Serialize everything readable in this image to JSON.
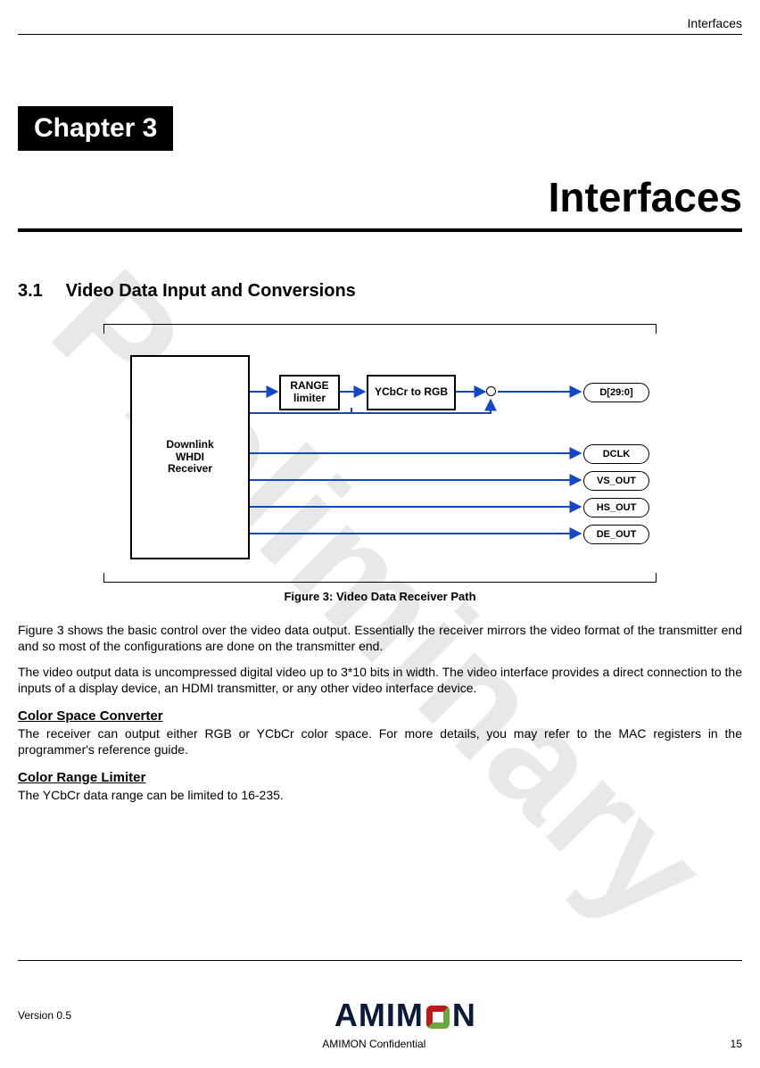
{
  "header": {
    "section": "Interfaces"
  },
  "chapter": {
    "banner": "Chapter 3",
    "title": "Interfaces"
  },
  "section": {
    "number": "3.1",
    "title": "Video Data Input and Conversions"
  },
  "figure": {
    "caption": "Figure 3: Video Data Receiver Path",
    "blocks": {
      "receiver": "Downlink\nWHDI\nReceiver",
      "range": "RANGE\nlimiter",
      "ycbcr": "YCbCr to RGB"
    },
    "pins": {
      "d": "D[29:0]",
      "dclk": "DCLK",
      "vs": "VS_OUT",
      "hs": "HS_OUT",
      "de": "DE_OUT"
    }
  },
  "paragraphs": {
    "p1": "Figure 3 shows the basic control over the video data output. Essentially the receiver mirrors the video format of the transmitter end and so most of the configurations are done on the transmitter end.",
    "p2": "The video output data is uncompressed digital video up to 3*10 bits in width. The video interface provides a direct connection to the inputs of a display device, an HDMI transmitter, or any other video interface device."
  },
  "sub1": {
    "heading": "Color Space Converter",
    "text": "The receiver can output either RGB or YCbCr color space. For more details, you may refer to the MAC registers in the programmer's reference guide."
  },
  "sub2": {
    "heading": "Color Range Limiter",
    "text": "The YCbCr data range can be limited to 16-235."
  },
  "footer": {
    "version": "Version 0.5",
    "confidential": "AMIMON Confidential",
    "page": "15",
    "logo_a": "AMIM",
    "logo_b": "N"
  },
  "watermark": "Preliminary"
}
